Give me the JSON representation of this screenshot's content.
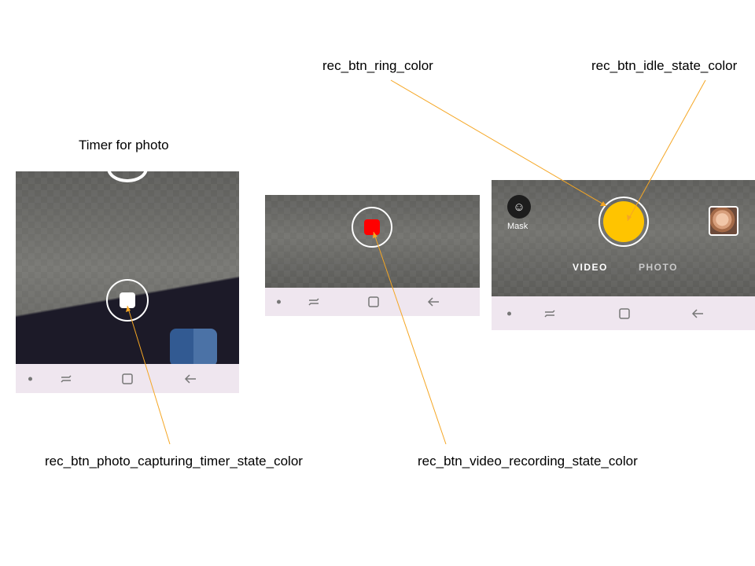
{
  "labels": {
    "timer_for_photo": "Timer for photo",
    "rec_btn_ring_color": "rec_btn_ring_color",
    "rec_btn_idle_state_color": "rec_btn_idle_state_color",
    "rec_btn_photo_capturing_timer_state_color": "rec_btn_photo_capturing_timer_state_color",
    "rec_btn_video_recording_state_color": "rec_btn_video_recording_state_color"
  },
  "camera": {
    "modes": {
      "video": "VIDEO",
      "photo": "PHOTO"
    },
    "mask_label": "Mask"
  },
  "colors": {
    "annotation_line": "#f5a623",
    "ring": "#ffffff",
    "idle_state": "#ffc400",
    "recording_state": "#ff0000",
    "timer_state": "#ffffff",
    "navbar": "#efe6ef"
  },
  "icons": [
    "dot-icon",
    "recents-icon",
    "home-square-icon",
    "back-arrow-icon",
    "mask-icon"
  ]
}
